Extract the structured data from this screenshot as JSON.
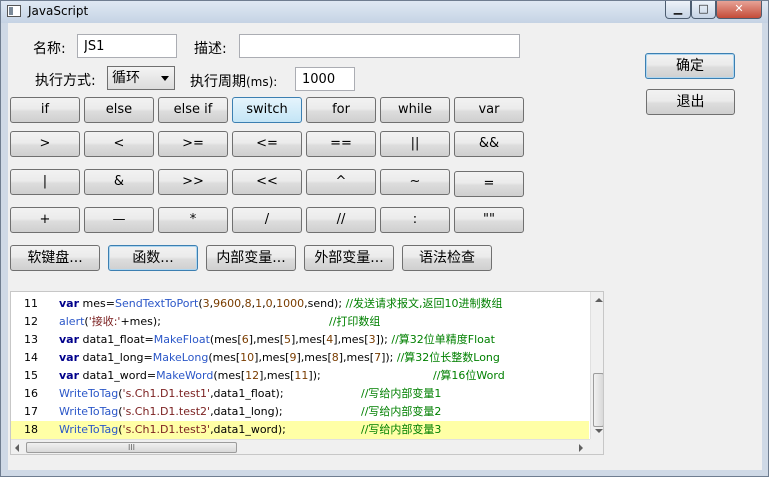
{
  "window": {
    "title": "JavaScript",
    "minimize_glyph": "▁",
    "maximize_glyph": "□",
    "close_glyph": "✕"
  },
  "form": {
    "name_label": "名称:",
    "name_value": "JS1",
    "desc_label": "描述:",
    "desc_value": "",
    "exec_mode_label": "执行方式:",
    "exec_mode_value": "循环",
    "exec_period_label": "执行周期",
    "exec_period_unit": "(ms):",
    "exec_period_value": "1000"
  },
  "actions": {
    "ok": "确定",
    "exit": "退出"
  },
  "keyword_buttons": [
    [
      "if",
      "else",
      "else if",
      "switch",
      "for",
      "while",
      "var"
    ],
    [
      ">",
      "<",
      ">=",
      "<=",
      "==",
      "||",
      "&&"
    ],
    [
      "|",
      "&",
      ">>",
      "<<",
      "^",
      "~",
      "="
    ],
    [
      "+",
      "—",
      "*",
      "/",
      "//",
      ":",
      "\"\""
    ]
  ],
  "active_keyword": "switch",
  "tool_buttons": [
    "软键盘...",
    "函数...",
    "内部变量...",
    "外部变量...",
    "语法检查"
  ],
  "editor": {
    "highlight_line": "18",
    "lines": [
      {
        "no": "11"
      },
      {
        "no": "12"
      },
      {
        "no": "13"
      },
      {
        "no": "14"
      },
      {
        "no": "15"
      },
      {
        "no": "16"
      },
      {
        "no": "17"
      },
      {
        "no": "18"
      }
    ],
    "hscroll_grip": "III"
  }
}
